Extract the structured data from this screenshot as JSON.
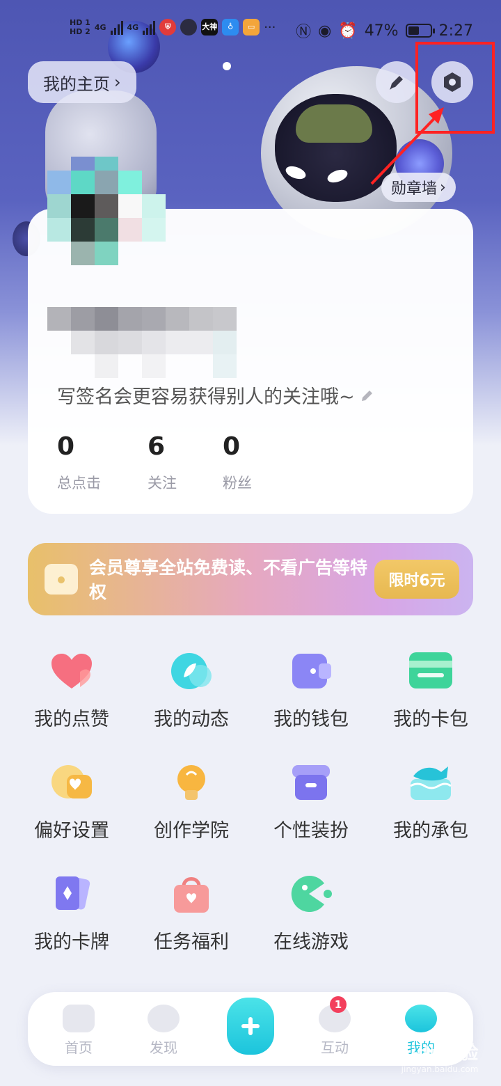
{
  "status_bar": {
    "time": "2:27",
    "battery": "47%",
    "signal": [
      "4G",
      "4G"
    ],
    "sim_labels": [
      "HD 1",
      "HD 2"
    ],
    "app_icon_label": "大神",
    "more": "···"
  },
  "header": {
    "home_label": "我的主页",
    "home_chevron": "›",
    "medal_wall": "勋章墙",
    "medal_chevron": "›",
    "edit_icon": "pencil-icon",
    "settings_icon": "settings-icon"
  },
  "profile": {
    "signature": "写签名会更容易获得别人的关注哦~",
    "stats": [
      {
        "value": "0",
        "label": "总点击"
      },
      {
        "value": "6",
        "label": "关注"
      },
      {
        "value": "0",
        "label": "粉丝"
      }
    ]
  },
  "vip": {
    "text": "会员尊享全站免费读、不看广告等特权",
    "button": "限时6元"
  },
  "menu": [
    {
      "label": "我的点赞",
      "icon": "heart-icon"
    },
    {
      "label": "我的动态",
      "icon": "leaf-icon"
    },
    {
      "label": "我的钱包",
      "icon": "wallet-icon"
    },
    {
      "label": "我的卡包",
      "icon": "card-icon"
    },
    {
      "label": "偏好设置",
      "icon": "preference-icon"
    },
    {
      "label": "创作学院",
      "icon": "bulb-icon"
    },
    {
      "label": "个性装扮",
      "icon": "store-icon"
    },
    {
      "label": "我的承包",
      "icon": "fish-icon"
    },
    {
      "label": "我的卡牌",
      "icon": "cards-icon"
    },
    {
      "label": "任务福利",
      "icon": "bag-icon"
    },
    {
      "label": "在线游戏",
      "icon": "pacman-icon"
    }
  ],
  "tabbar": {
    "tabs": [
      {
        "label": "首页",
        "icon": "home-icon"
      },
      {
        "label": "发现",
        "icon": "discover-icon"
      },
      {
        "label": "互动",
        "icon": "chat-icon",
        "badge": "1"
      },
      {
        "label": "我的",
        "icon": "me-icon"
      }
    ],
    "add_icon": "plus-icon"
  },
  "watermark": {
    "main": "Baidu经验",
    "sub": "jingyan.baidu.com"
  },
  "colors": {
    "annotation": "#ff2222",
    "accent_cyan": "#1cc4dc",
    "badge_red": "#f33f5c",
    "vip_gold": "#e7b850"
  }
}
